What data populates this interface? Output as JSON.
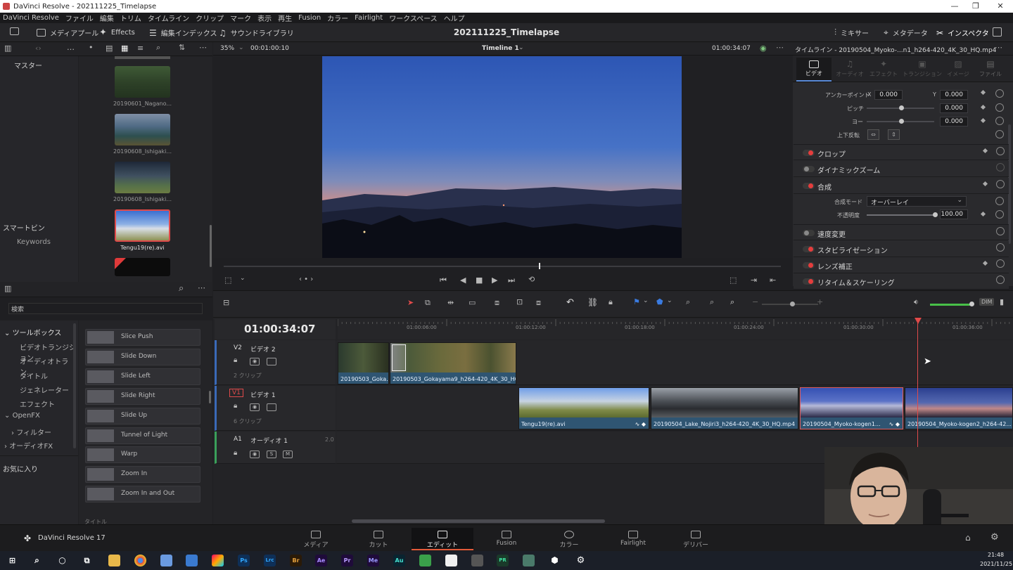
{
  "window": {
    "title": "DaVinci Resolve - 202111225_Timelapse",
    "controls": [
      "—",
      "❐",
      "✕"
    ]
  },
  "menu": [
    "DaVinci Resolve",
    "ファイル",
    "編集",
    "トリム",
    "タイムライン",
    "クリップ",
    "マーク",
    "表示",
    "再生",
    "Fusion",
    "カラー",
    "Fairlight",
    "ワークスペース",
    "ヘルプ"
  ],
  "toolbar": {
    "media_pool": "メディアプール",
    "effects": "Effects",
    "edit_index": "編集インデックス",
    "sound_library": "サウンドライブラリ",
    "project_title": "202111225_Timelapse",
    "mixer": "ミキサー",
    "metadata": "メタデータ",
    "inspector": "インスペクタ"
  },
  "viewer": {
    "zoom": "35%",
    "source_tc": "00:01:00:10",
    "timeline_name": "Timeline 1",
    "record_tc": "01:00:34:07"
  },
  "media_pool": {
    "master": "マスター",
    "smart_bin": "スマートビン",
    "keywords": "Keywords",
    "clips": [
      {
        "name": "20190601_Nagano...",
        "selected": false
      },
      {
        "name": "20190608_Ishigaki...",
        "selected": false
      },
      {
        "name": "20190608_Ishigaki...",
        "selected": false
      },
      {
        "name": "Tengu19(re).avi",
        "selected": true
      }
    ]
  },
  "effects": {
    "search_placeholder": "検索",
    "tree": [
      {
        "label": "ツールボックス",
        "level": 0,
        "expanded": true
      },
      {
        "label": "ビデオトランジション",
        "level": 1,
        "selected": true
      },
      {
        "label": "オーディオトラン...",
        "level": 1
      },
      {
        "label": "タイトル",
        "level": 1
      },
      {
        "label": "ジェネレーター",
        "level": 1
      },
      {
        "label": "エフェクト",
        "level": 1
      },
      {
        "label": "OpenFX",
        "level": 0,
        "expanded": true
      },
      {
        "label": "フィルター",
        "level": 1
      },
      {
        "label": "オーディオFX",
        "level": 0
      }
    ],
    "favorites": "お気に入り",
    "items": [
      "Slice Push",
      "Slide Down",
      "Slide Left",
      "Slide Right",
      "Slide Up",
      "Tunnel of Light",
      "Warp",
      "Zoom In",
      "Zoom In and Out"
    ],
    "footer": "タイトル"
  },
  "inspector": {
    "header": "タイムライン - 20190504_Myoko-...n1_h264-420_4K_30_HQ.mp4",
    "tabs": [
      "ビデオ",
      "オーディオ",
      "エフェクト",
      "トランジション",
      "イメージ",
      "ファイル"
    ],
    "anchor_label": "アンカーポイント",
    "anchor_x_label": "X",
    "anchor_x": "0.000",
    "anchor_y_label": "Y",
    "anchor_y": "0.000",
    "pitch_label": "ピッチ",
    "pitch": "0.000",
    "yaw_label": "ヨー",
    "yaw": "0.000",
    "flip_label": "上下反転",
    "sections": [
      {
        "label": "クロップ",
        "on": true
      },
      {
        "label": "ダイナミックズーム",
        "on": false
      },
      {
        "label": "合成",
        "on": true
      },
      {
        "label": "速度変更",
        "on": false
      },
      {
        "label": "スタビライゼーション",
        "on": true
      },
      {
        "label": "レンズ補正",
        "on": true
      },
      {
        "label": "リタイム＆スケーリング",
        "on": true
      }
    ],
    "blend_mode_label": "合成モード",
    "blend_mode": "オーバーレイ",
    "opacity_label": "不透明度",
    "opacity": "100.00"
  },
  "timeline": {
    "timecode": "01:00:34:07",
    "ruler": [
      "01:00:06:00",
      "01:00:12:00",
      "01:00:18:00",
      "01:00:24:00",
      "01:00:30:00",
      "01:00:36:00"
    ],
    "tracks": [
      {
        "id": "V2",
        "name": "ビデオ 2",
        "clips": "2 クリップ"
      },
      {
        "id": "V1",
        "name": "ビデオ 1",
        "clips": "6 クリップ"
      },
      {
        "id": "A1",
        "name": "オーディオ 1",
        "level": "2.0"
      }
    ],
    "v2_clips": [
      "20190503_Goka...",
      "20190503_Gokayama9_h264-420_4K_30_HQ..."
    ],
    "v1_clips": [
      "Tengu19(re).avi",
      "20190504_Lake_Nojiri3_h264-420_4K_30_HQ.mp4",
      "20190504_Myoko-kogen1...",
      "20190504_Myoko-kogen2_h264-42..."
    ],
    "solo": "S",
    "mute": "M"
  },
  "pages": [
    {
      "label": "メディア",
      "active": false
    },
    {
      "label": "カット",
      "active": false
    },
    {
      "label": "エディット",
      "active": true
    },
    {
      "label": "Fusion",
      "active": false
    },
    {
      "label": "カラー",
      "active": false
    },
    {
      "label": "Fairlight",
      "active": false
    },
    {
      "label": "デリバー",
      "active": false
    }
  ],
  "app_brand": "DaVinci Resolve 17",
  "taskbar": {
    "apps": [
      "Ps",
      "Lrc",
      "Br",
      "Ae",
      "Pr",
      "Me",
      "Au",
      "PR"
    ],
    "time": "21:48",
    "date": "2021/11/25"
  }
}
